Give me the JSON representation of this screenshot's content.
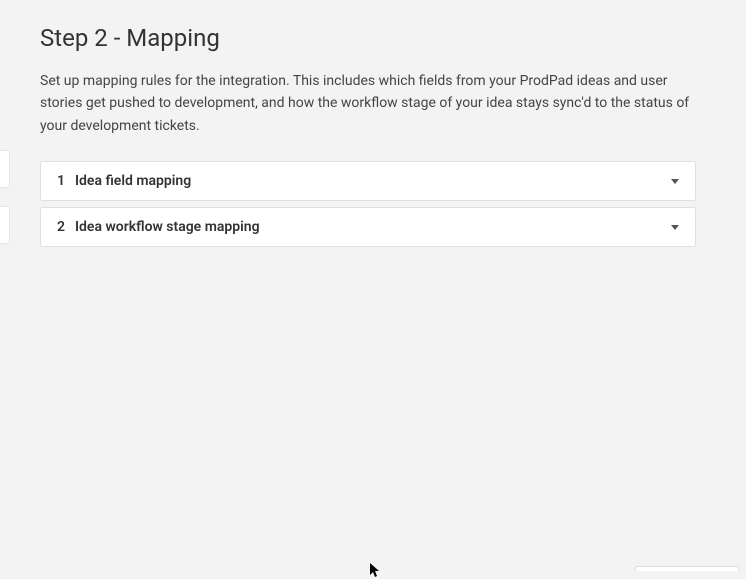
{
  "header": {
    "title": "Step 2 - Mapping",
    "description": "Set up mapping rules for the integration. This includes which fields from your ProdPad ideas and user stories get pushed to development, and how the workflow stage of your idea stays sync'd to the status of your development tickets."
  },
  "accordion": {
    "items": [
      {
        "number": "1",
        "label": "Idea field mapping"
      },
      {
        "number": "2",
        "label": "Idea workflow stage mapping"
      }
    ]
  }
}
